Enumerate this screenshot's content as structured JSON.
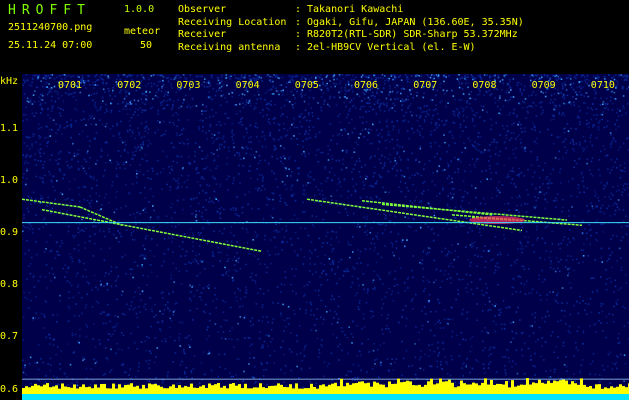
{
  "header": {
    "app_title": "HROFFT",
    "app_version": "1.0.0",
    "file_name": "2511240700.png",
    "meteor_label": "meteor",
    "meteor_count": "50",
    "date_time": "25.11.24 07:00"
  },
  "info": [
    {
      "key": "Observer",
      "value": "Takanori Kawachi"
    },
    {
      "key": "Receiving Location",
      "value": "Ogaki, Gifu, JAPAN (136.60E, 35.35N)"
    },
    {
      "key": "Receiver",
      "value": "R820T2(RTL-SDR) SDR-Sharp 53.372MHz"
    },
    {
      "key": "Receiving antenna",
      "value": "2el-HB9CV Vertical (el. E-W)"
    }
  ],
  "spectrogram": {
    "y_unit": "kHz",
    "y_ticks": [
      "1.1",
      "1.0",
      "0.9",
      "0.8",
      "0.7",
      "0.6"
    ],
    "y_range": [
      0.58,
      1.205
    ],
    "x_ticks": [
      "0701",
      "0702",
      "0703",
      "0704",
      "0705",
      "0706",
      "0707",
      "0708",
      "0709",
      "0710"
    ],
    "reference_line_khz": 0.92,
    "colors": {
      "background": "#00004a",
      "noise_low": "#0a2a9a",
      "noise_high": "#3aa0ff",
      "trace": "#7fff3a",
      "trace_hot": "#ff3060",
      "axis_text": "#ffff00",
      "reference_line": "#3ce0ff",
      "activity_bar": "#ffff00",
      "baseline": "#00e5ff"
    }
  }
}
